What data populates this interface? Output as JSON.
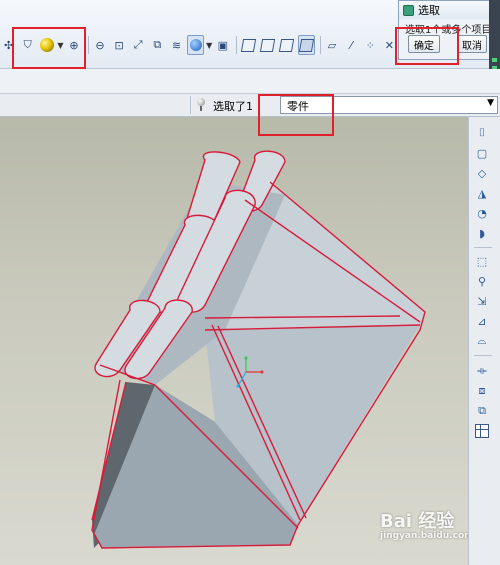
{
  "dialog": {
    "title": "选取",
    "message": "选取1个或多个项目。",
    "ok_label": "确定",
    "cancel_label": "取消"
  },
  "filter": {
    "status_text": "选取了1",
    "selected_filter": "零件"
  },
  "toolbar": {
    "icons": [
      "shield-icon",
      "sphere-icon",
      "zoom-in-icon",
      "zoom-out-icon",
      "zoom-fit-icon",
      "reorient-icon",
      "view-manager-icon",
      "layers-icon",
      "display-style-icon",
      "saved-views-icon",
      "wireframe-icon",
      "hidden-line-icon",
      "no-hidden-icon",
      "shading-icon",
      "datum-plane-icon",
      "datum-axis-icon",
      "datum-point-icon"
    ]
  },
  "palette": {
    "icons": [
      "hole-icon",
      "shell-icon",
      "rib-icon",
      "draft-icon",
      "round-icon",
      "chamfer-icon",
      "extrude-icon",
      "sweep-icon",
      "blend-icon",
      "variable-sweep-icon",
      "boundary-icon",
      "mirror-icon",
      "pattern-icon",
      "copy-icon",
      "grid-icon"
    ]
  },
  "watermark": {
    "brand": "Bai 经验",
    "url": "jingyan.baidu.com"
  },
  "colors": {
    "highlight": "#e0202a",
    "selection_edge": "#d81b3a",
    "model_face": "#c4ccd3"
  }
}
